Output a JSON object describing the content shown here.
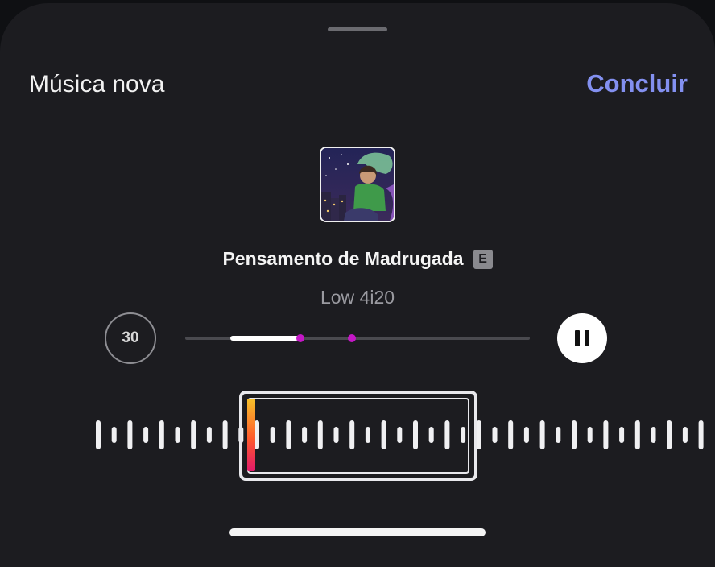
{
  "header": {
    "title": "Música nova",
    "done_label": "Concluir"
  },
  "track": {
    "title": "Pensamento de Madrugada",
    "explicit_badge": "E",
    "artist": "Low 4i20"
  },
  "controls": {
    "duration_label": "30",
    "playback_state": "playing",
    "progress_start_fraction": 0.13,
    "progress_end_fraction": 0.33
  },
  "colors": {
    "accent": "#8390f0",
    "marker": "#c417c6",
    "background": "#1c1c20"
  },
  "icons": {
    "duration": "clip-duration-icon",
    "pause": "pause-icon",
    "explicit": "explicit-icon"
  }
}
